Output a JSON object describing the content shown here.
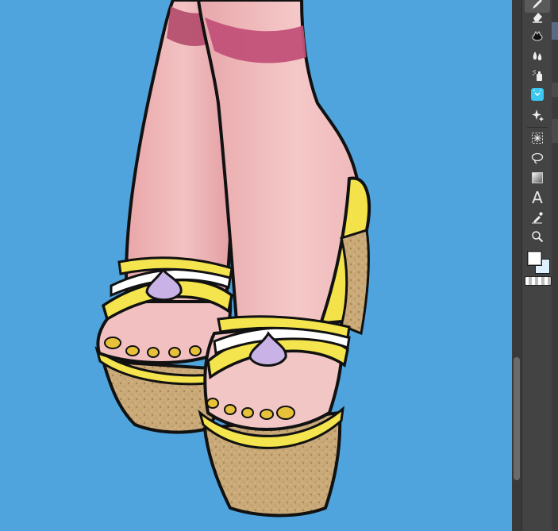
{
  "app": {
    "canvas_background": "#4fa4dd",
    "toolbar_background": "#434343"
  },
  "toolbar": {
    "tools": [
      {
        "name": "pen-tool",
        "active": true
      },
      {
        "name": "eraser-tool"
      },
      {
        "name": "decoration-tool"
      },
      {
        "name": "blend-tool"
      },
      {
        "name": "airbrush-tool"
      },
      {
        "name": "fill-tool"
      },
      {
        "name": "figure-tool"
      },
      {
        "name": "selection-tool"
      },
      {
        "name": "lasso-tool"
      },
      {
        "name": "gradient-tool"
      },
      {
        "name": "text-tool",
        "glyph": "A"
      },
      {
        "name": "eyedropper-tool"
      },
      {
        "name": "zoom-tool"
      }
    ],
    "colors": {
      "main": "#ffffff",
      "sub": "#dff1ff"
    }
  }
}
